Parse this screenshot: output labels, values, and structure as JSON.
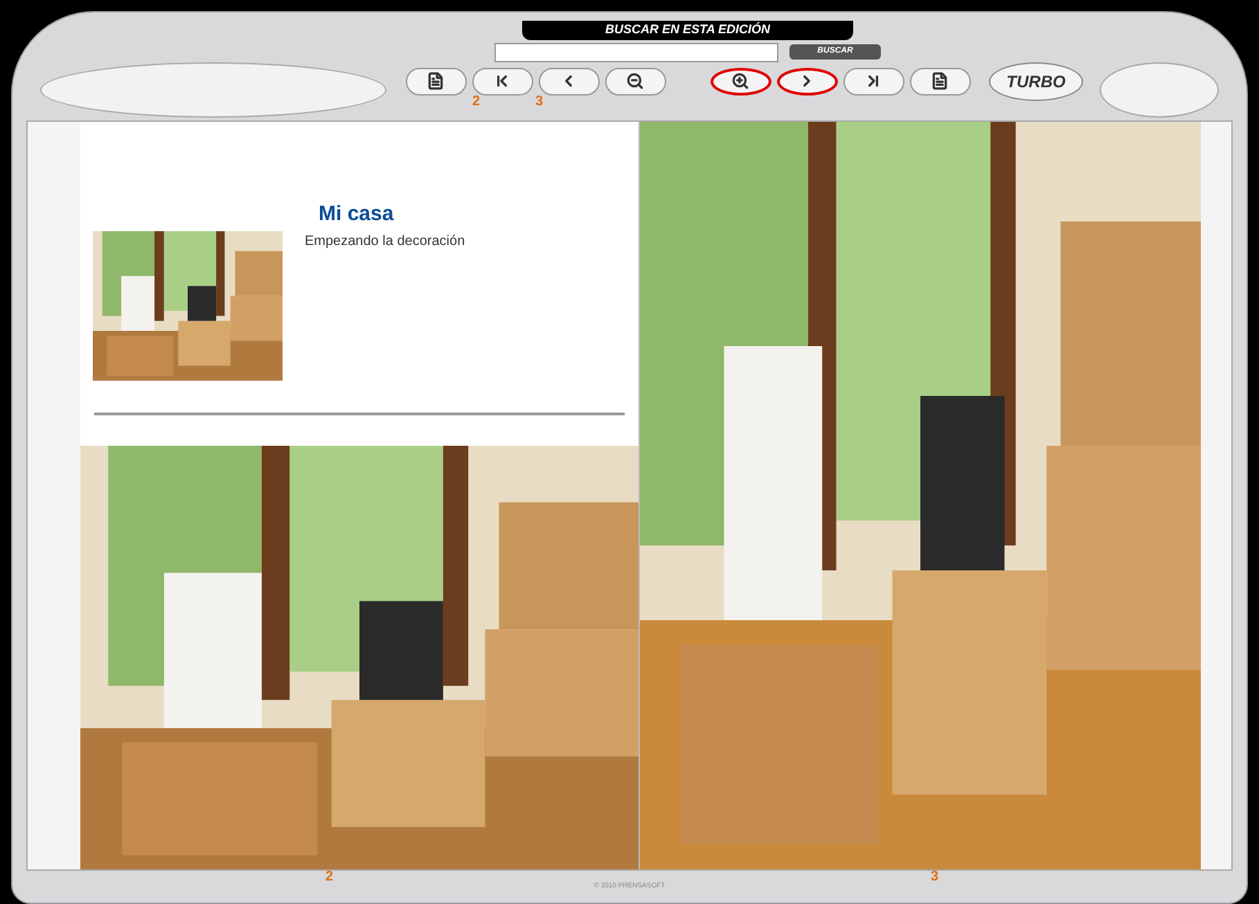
{
  "search": {
    "title": "BUSCAR EN ESTA EDICIÓN",
    "button": "BUSCAR"
  },
  "toolbar": [
    {
      "kind": "page",
      "circled": false
    },
    {
      "kind": "first",
      "circled": false
    },
    {
      "kind": "prev",
      "circled": false
    },
    {
      "kind": "zoom-out",
      "circled": false
    },
    {
      "kind": "zoom-in",
      "circled": true
    },
    {
      "kind": "next",
      "circled": true
    },
    {
      "kind": "last",
      "circled": false
    },
    {
      "kind": "page",
      "circled": false
    }
  ],
  "turbo": "TURBO",
  "page_indicator": [
    "2",
    "3"
  ],
  "left_page": {
    "title": "Mi casa",
    "subtitle": "Empezando la decoración"
  },
  "page_numbers": [
    "2",
    "3"
  ],
  "footer": "© 2010 PRENSASOFT"
}
